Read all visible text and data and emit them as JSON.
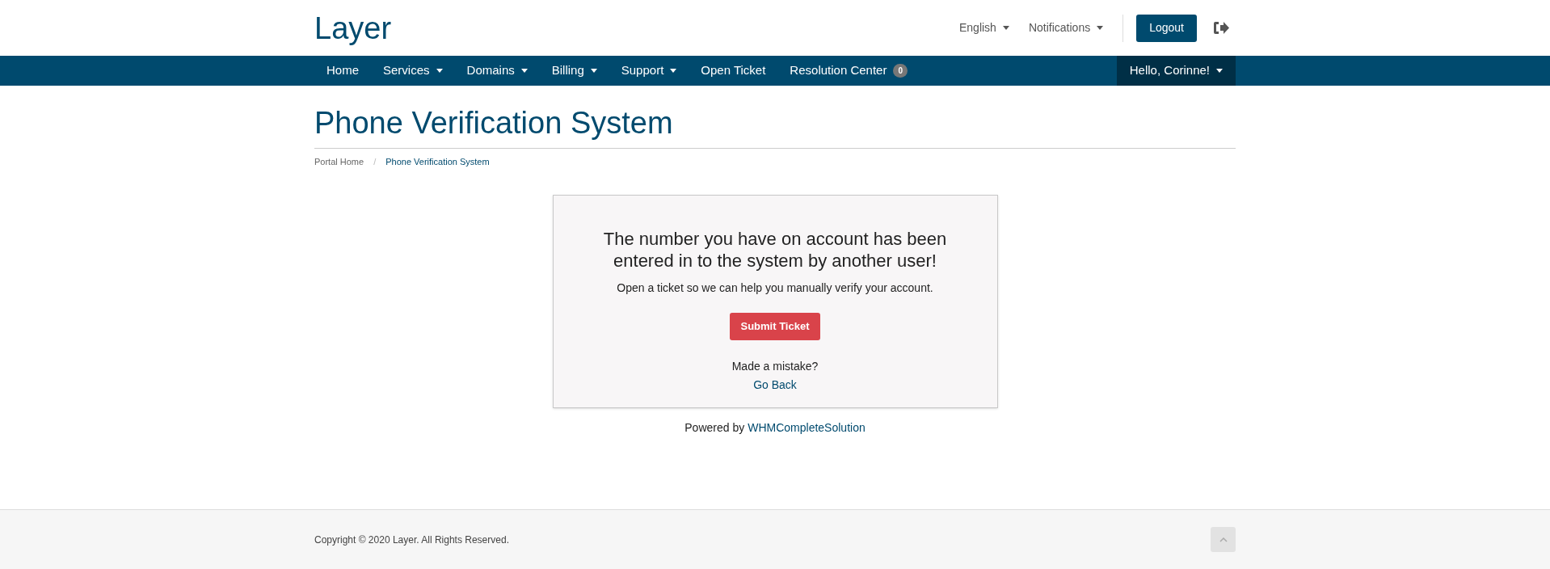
{
  "header": {
    "logo": "Layer",
    "links": [
      {
        "label": "English",
        "dropdown": true
      },
      {
        "label": "Notifications",
        "dropdown": true
      }
    ],
    "logout": "Logout"
  },
  "nav": {
    "items": [
      {
        "label": "Home",
        "dropdown": false
      },
      {
        "label": "Services",
        "dropdown": true
      },
      {
        "label": "Domains",
        "dropdown": true
      },
      {
        "label": "Billing",
        "dropdown": true
      },
      {
        "label": "Support",
        "dropdown": true
      },
      {
        "label": "Open Ticket",
        "dropdown": false
      },
      {
        "label": "Resolution Center",
        "dropdown": false,
        "badge": "0"
      }
    ],
    "user": {
      "label": "Hello, Corinne!",
      "dropdown": true
    }
  },
  "page": {
    "title": "Phone Verification System",
    "separator": "/",
    "breadcrumb": [
      {
        "label": "Portal Home",
        "selected": false
      },
      {
        "label": "Phone Verification System",
        "selected": true
      }
    ]
  },
  "card": {
    "heading": "The number you have on account has been entered in to the system by another user!",
    "message": "Open a ticket so we can help you manually verify your account.",
    "button": "Submit Ticket",
    "mistake": "Made a mistake?",
    "back_link": "Go Back"
  },
  "powered": {
    "text": "Powered by",
    "link": "WHMCompleteSolution"
  },
  "footer": {
    "copyright": "Copyright © 2020 Layer. All Rights Reserved."
  }
}
